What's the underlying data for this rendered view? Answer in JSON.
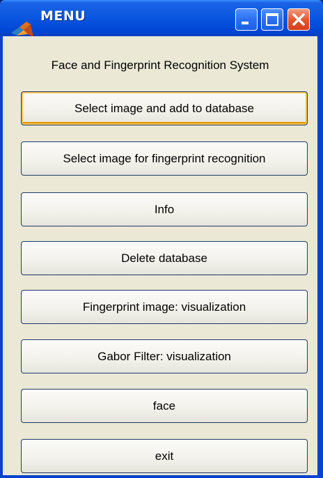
{
  "window": {
    "title": "MENU",
    "icon": "matlab-logo-icon",
    "controls": [
      "minimize-icon",
      "maximize-icon",
      "close-icon"
    ]
  },
  "heading": "Face and Fingerprint Recognition System",
  "buttons": [
    {
      "label": "Select image and add to database",
      "focused": true
    },
    {
      "label": "Select image for fingerprint recognition",
      "focused": false
    },
    {
      "label": "Info",
      "focused": false
    },
    {
      "label": "Delete database",
      "focused": false
    },
    {
      "label": "Fingerprint image: visualization",
      "focused": false
    },
    {
      "label": "Gabor Filter: visualization",
      "focused": false
    },
    {
      "label": "face",
      "focused": false
    },
    {
      "label": "exit",
      "focused": false
    }
  ],
  "colors": {
    "titlebar": "#0a56e0",
    "client_bg": "#ebe9d6",
    "close_button": "#e4532a",
    "focus_ring": "#f4c155"
  }
}
